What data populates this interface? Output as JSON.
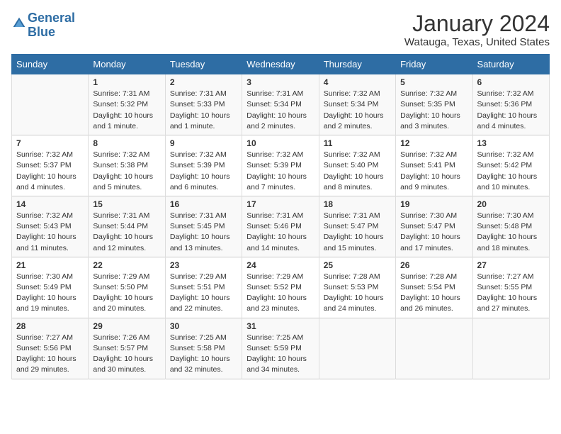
{
  "logo": {
    "text_general": "General",
    "text_blue": "Blue"
  },
  "title": "January 2024",
  "subtitle": "Watauga, Texas, United States",
  "headers": [
    "Sunday",
    "Monday",
    "Tuesday",
    "Wednesday",
    "Thursday",
    "Friday",
    "Saturday"
  ],
  "weeks": [
    [
      {
        "day": "",
        "info": ""
      },
      {
        "day": "1",
        "info": "Sunrise: 7:31 AM\nSunset: 5:32 PM\nDaylight: 10 hours\nand 1 minute."
      },
      {
        "day": "2",
        "info": "Sunrise: 7:31 AM\nSunset: 5:33 PM\nDaylight: 10 hours\nand 1 minute."
      },
      {
        "day": "3",
        "info": "Sunrise: 7:31 AM\nSunset: 5:34 PM\nDaylight: 10 hours\nand 2 minutes."
      },
      {
        "day": "4",
        "info": "Sunrise: 7:32 AM\nSunset: 5:34 PM\nDaylight: 10 hours\nand 2 minutes."
      },
      {
        "day": "5",
        "info": "Sunrise: 7:32 AM\nSunset: 5:35 PM\nDaylight: 10 hours\nand 3 minutes."
      },
      {
        "day": "6",
        "info": "Sunrise: 7:32 AM\nSunset: 5:36 PM\nDaylight: 10 hours\nand 4 minutes."
      }
    ],
    [
      {
        "day": "7",
        "info": "Sunrise: 7:32 AM\nSunset: 5:37 PM\nDaylight: 10 hours\nand 4 minutes."
      },
      {
        "day": "8",
        "info": "Sunrise: 7:32 AM\nSunset: 5:38 PM\nDaylight: 10 hours\nand 5 minutes."
      },
      {
        "day": "9",
        "info": "Sunrise: 7:32 AM\nSunset: 5:39 PM\nDaylight: 10 hours\nand 6 minutes."
      },
      {
        "day": "10",
        "info": "Sunrise: 7:32 AM\nSunset: 5:39 PM\nDaylight: 10 hours\nand 7 minutes."
      },
      {
        "day": "11",
        "info": "Sunrise: 7:32 AM\nSunset: 5:40 PM\nDaylight: 10 hours\nand 8 minutes."
      },
      {
        "day": "12",
        "info": "Sunrise: 7:32 AM\nSunset: 5:41 PM\nDaylight: 10 hours\nand 9 minutes."
      },
      {
        "day": "13",
        "info": "Sunrise: 7:32 AM\nSunset: 5:42 PM\nDaylight: 10 hours\nand 10 minutes."
      }
    ],
    [
      {
        "day": "14",
        "info": "Sunrise: 7:32 AM\nSunset: 5:43 PM\nDaylight: 10 hours\nand 11 minutes."
      },
      {
        "day": "15",
        "info": "Sunrise: 7:31 AM\nSunset: 5:44 PM\nDaylight: 10 hours\nand 12 minutes."
      },
      {
        "day": "16",
        "info": "Sunrise: 7:31 AM\nSunset: 5:45 PM\nDaylight: 10 hours\nand 13 minutes."
      },
      {
        "day": "17",
        "info": "Sunrise: 7:31 AM\nSunset: 5:46 PM\nDaylight: 10 hours\nand 14 minutes."
      },
      {
        "day": "18",
        "info": "Sunrise: 7:31 AM\nSunset: 5:47 PM\nDaylight: 10 hours\nand 15 minutes."
      },
      {
        "day": "19",
        "info": "Sunrise: 7:30 AM\nSunset: 5:47 PM\nDaylight: 10 hours\nand 17 minutes."
      },
      {
        "day": "20",
        "info": "Sunrise: 7:30 AM\nSunset: 5:48 PM\nDaylight: 10 hours\nand 18 minutes."
      }
    ],
    [
      {
        "day": "21",
        "info": "Sunrise: 7:30 AM\nSunset: 5:49 PM\nDaylight: 10 hours\nand 19 minutes."
      },
      {
        "day": "22",
        "info": "Sunrise: 7:29 AM\nSunset: 5:50 PM\nDaylight: 10 hours\nand 20 minutes."
      },
      {
        "day": "23",
        "info": "Sunrise: 7:29 AM\nSunset: 5:51 PM\nDaylight: 10 hours\nand 22 minutes."
      },
      {
        "day": "24",
        "info": "Sunrise: 7:29 AM\nSunset: 5:52 PM\nDaylight: 10 hours\nand 23 minutes."
      },
      {
        "day": "25",
        "info": "Sunrise: 7:28 AM\nSunset: 5:53 PM\nDaylight: 10 hours\nand 24 minutes."
      },
      {
        "day": "26",
        "info": "Sunrise: 7:28 AM\nSunset: 5:54 PM\nDaylight: 10 hours\nand 26 minutes."
      },
      {
        "day": "27",
        "info": "Sunrise: 7:27 AM\nSunset: 5:55 PM\nDaylight: 10 hours\nand 27 minutes."
      }
    ],
    [
      {
        "day": "28",
        "info": "Sunrise: 7:27 AM\nSunset: 5:56 PM\nDaylight: 10 hours\nand 29 minutes."
      },
      {
        "day": "29",
        "info": "Sunrise: 7:26 AM\nSunset: 5:57 PM\nDaylight: 10 hours\nand 30 minutes."
      },
      {
        "day": "30",
        "info": "Sunrise: 7:25 AM\nSunset: 5:58 PM\nDaylight: 10 hours\nand 32 minutes."
      },
      {
        "day": "31",
        "info": "Sunrise: 7:25 AM\nSunset: 5:59 PM\nDaylight: 10 hours\nand 34 minutes."
      },
      {
        "day": "",
        "info": ""
      },
      {
        "day": "",
        "info": ""
      },
      {
        "day": "",
        "info": ""
      }
    ]
  ]
}
